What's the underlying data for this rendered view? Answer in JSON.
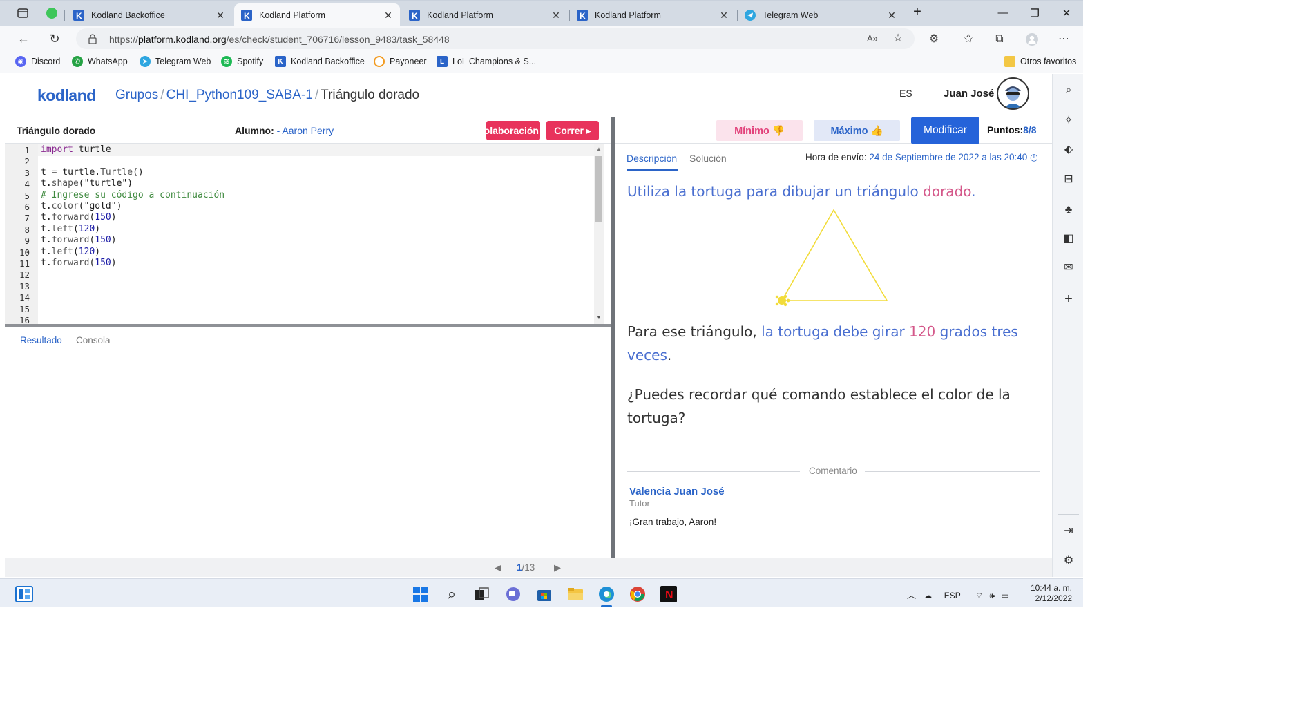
{
  "browser": {
    "tabs": [
      {
        "title": "Kodland Backoffice",
        "active": false
      },
      {
        "title": "Kodland Platform",
        "active": true
      },
      {
        "title": "Kodland Platform",
        "active": false
      },
      {
        "title": "Kodland Platform",
        "active": false
      },
      {
        "title": "Telegram Web",
        "active": false
      }
    ],
    "url_prefix": "https://",
    "url_host": "platform.kodland.org",
    "url_path": "/es/check/student_706716/lesson_9483/task_58448",
    "bookmarks": [
      "Discord",
      "WhatsApp",
      "Telegram Web",
      "Spotify",
      "Kodland Backoffice",
      "Payoneer",
      "LoL Champions & S..."
    ],
    "other_favorites": "Otros favoritos"
  },
  "header": {
    "logo": "kodland",
    "crumb_groups": "Grupos",
    "crumb_sep": "/",
    "crumb_group_name": "CHI_Python109_SABA-1",
    "crumb_current": "Triángulo dorado",
    "lang": "ES",
    "user": "Juan José"
  },
  "editor": {
    "task_name": "Triángulo dorado",
    "student_label": "Alumno:",
    "student_name": "- Aaron Perry",
    "collab_button": "Colaboración",
    "run_button": "Correr ▸",
    "line_numbers": [
      "1",
      "2",
      "3",
      "4",
      "5",
      "6",
      "7",
      "8",
      "9",
      "10",
      "11",
      "12",
      "13",
      "14",
      "15",
      "16"
    ],
    "code_lines": [
      {
        "kw": "import",
        "rest": " turtle"
      },
      {
        "plain": ""
      },
      {
        "a": "t = turtle.",
        "m": "Turtle",
        "b": "()"
      },
      {
        "a": "t.",
        "m": "shape",
        "b": "(\"turtle\")"
      },
      {
        "comment": "# Ingrese su código a continuación"
      },
      {
        "a": "t.",
        "m": "color",
        "b": "(\"gold\")"
      },
      {
        "a": "t.",
        "m": "forward",
        "n": "150"
      },
      {
        "a": "t.",
        "m": "left",
        "n": "120"
      },
      {
        "a": "t.",
        "m": "forward",
        "n": "150"
      },
      {
        "a": "t.",
        "m": "left",
        "n": "120"
      },
      {
        "a": "t.",
        "m": "forward",
        "n": "150"
      }
    ],
    "tab_result": "Resultado",
    "tab_console": "Consola"
  },
  "review": {
    "min_button": "Mínimo 👎",
    "max_button": "Máximo 👍",
    "modify_button": "Modificar",
    "points_label": "Puntos:",
    "points_value": "8/8",
    "tab_description": "Descripción",
    "tab_solution": "Solución",
    "send_time_label": "Hora de envío:",
    "send_time_value": "24 de Septiembre de 2022 a las 20:40",
    "desc1_blue": "Utiliza la tortuga para dibujar un triángulo ",
    "desc1_pink": "dorado",
    "desc1_end": ".",
    "desc2_a": "Para ese triángulo, ",
    "desc2_blue1": "la tortuga debe girar ",
    "desc2_pink": "120",
    "desc2_blue2": " grados tres veces",
    "desc2_end": ".",
    "desc3": "¿Puedes recordar qué comando establece el color de la tortuga?",
    "comment_label": "Comentario",
    "tutor_name": "Valencia Juan José",
    "tutor_role": "Tutor",
    "tutor_message": "¡Gran trabajo, Aaron!"
  },
  "pager": {
    "current": "1",
    "total": "/13"
  },
  "system": {
    "lang": "ESP",
    "time": "10:44 a. m.",
    "date": "2/12/2022"
  },
  "colors": {
    "accent": "#2b64c8",
    "pink_button": "#e8335c",
    "triangle": "#f2dc3a",
    "min_bg": "#fbe3ec",
    "max_bg": "#e2e8f7"
  }
}
